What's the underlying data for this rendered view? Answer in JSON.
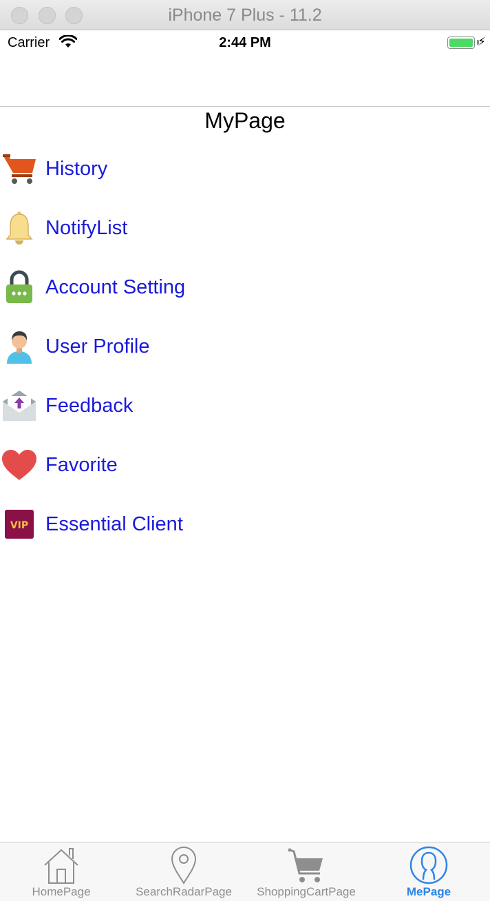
{
  "window": {
    "title": "iPhone 7 Plus - 11.2"
  },
  "status_bar": {
    "carrier": "Carrier",
    "time": "2:44 PM",
    "battery_level": 1.0
  },
  "page": {
    "title": "MyPage"
  },
  "menu": {
    "items": [
      {
        "label": "History",
        "icon": "shopping-cart-icon"
      },
      {
        "label": "NotifyList",
        "icon": "bell-icon"
      },
      {
        "label": "Account Setting",
        "icon": "lock-icon"
      },
      {
        "label": "User Profile",
        "icon": "user-icon"
      },
      {
        "label": "Feedback",
        "icon": "envelope-upload-icon"
      },
      {
        "label": "Favorite",
        "icon": "heart-icon"
      },
      {
        "label": "Essential Client",
        "icon": "vip-badge-icon",
        "badge_text": "VIP"
      }
    ]
  },
  "tabbar": {
    "active_index": 3,
    "tabs": [
      {
        "label": "HomePage",
        "icon": "house-icon"
      },
      {
        "label": "SearchRadarPage",
        "icon": "location-pin-icon"
      },
      {
        "label": "ShoppingCartPage",
        "icon": "shopping-cart-icon"
      },
      {
        "label": "MePage",
        "icon": "person-circle-icon"
      }
    ]
  },
  "colors": {
    "link": "#1a1adb",
    "tab_active": "#2d86e6",
    "tab_inactive": "#8e8e8e",
    "battery": "#4cd964"
  }
}
